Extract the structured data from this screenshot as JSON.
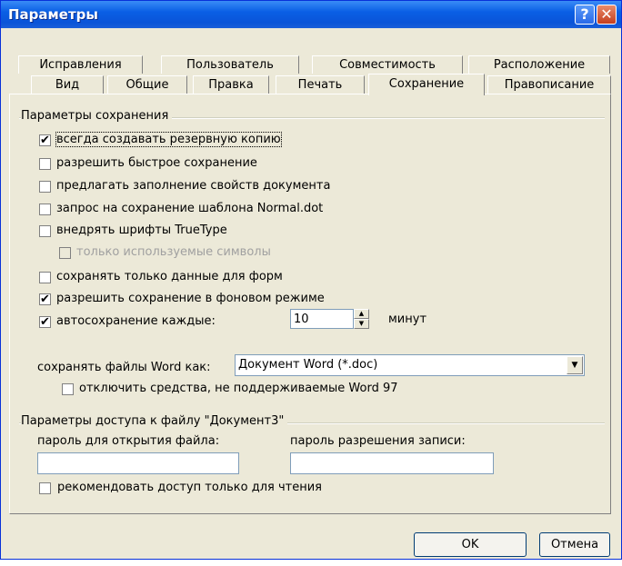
{
  "window": {
    "title": "Параметры",
    "help_glyph": "?",
    "close_glyph": "✕"
  },
  "tabs_row1": [
    "Исправления",
    "Пользователь",
    "Совместимость",
    "Расположение"
  ],
  "tabs_row2": [
    "Вид",
    "Общие",
    "Правка",
    "Печать",
    "Сохранение",
    "Правописание"
  ],
  "active_tab": "Сохранение",
  "save_group": {
    "title": "Параметры сохранения",
    "options": [
      {
        "label": "всегда создавать резервную копию",
        "checked": true
      },
      {
        "label": "разрешить быстрое сохранение",
        "checked": false
      },
      {
        "label": "предлагать заполнение свойств документа",
        "checked": false
      },
      {
        "label": "запрос на сохранение шаблона Normal.dot",
        "checked": false
      },
      {
        "label": "внедрять шрифты TrueType",
        "checked": false
      },
      {
        "label": "только используемые символы",
        "checked": false,
        "disabled": true
      },
      {
        "label": "сохранять только данные для форм",
        "checked": false
      },
      {
        "label": "разрешить сохранение в фоновом режиме",
        "checked": true
      },
      {
        "label": "автосохранение каждые:",
        "checked": true
      }
    ],
    "autosave_value": "10",
    "autosave_unit": "минут",
    "save_as_label": "сохранять файлы Word как:",
    "save_as_value": "Документ Word (*.doc)",
    "disable_features_label": "отключить средства, не поддерживаемые Word 97",
    "disable_features_checked": false
  },
  "access_group": {
    "title": "Параметры доступа к файлу \"Документ3\"",
    "open_password_label": "пароль для открытия файла:",
    "write_password_label": "пароль разрешения записи:",
    "open_password_value": "",
    "write_password_value": "",
    "readonly_label": "рекомендовать доступ только для чтения",
    "readonly_checked": false
  },
  "buttons": {
    "ok": "OK",
    "cancel": "Отмена"
  },
  "check_glyph": "✔",
  "dropdown_glyph": "▼",
  "spin_up_glyph": "▲",
  "spin_down_glyph": "▼"
}
